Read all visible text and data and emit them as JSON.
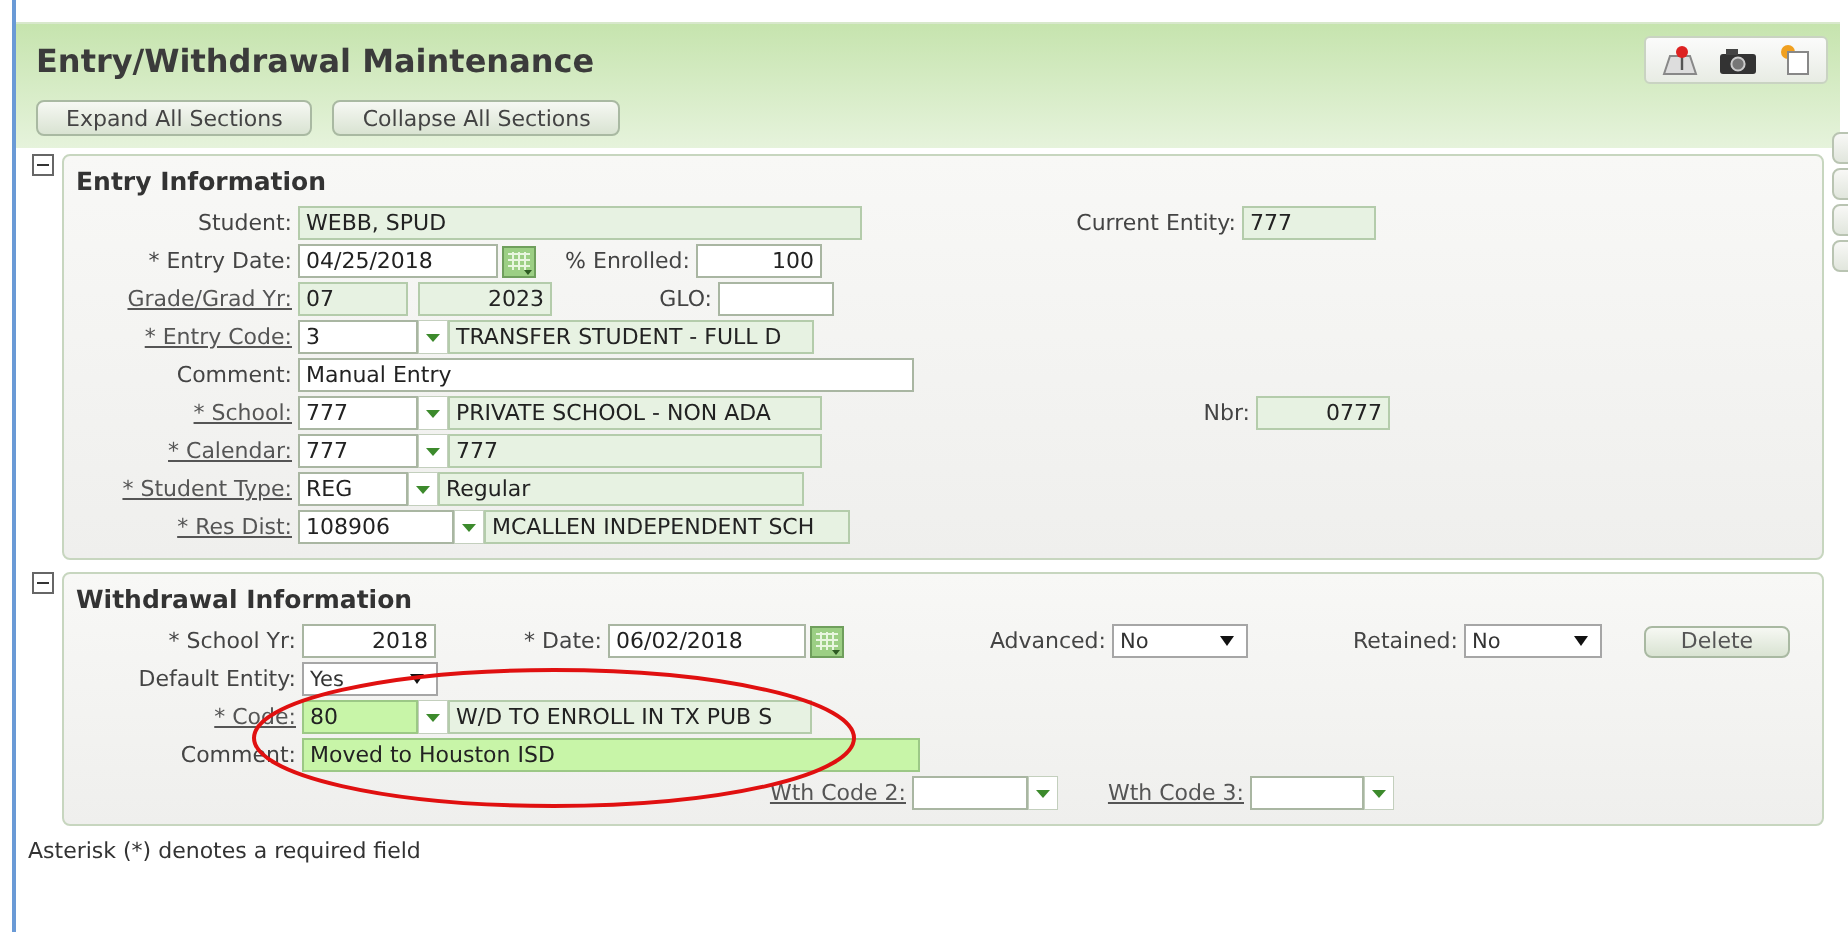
{
  "title": "Entry/Withdrawal Maintenance",
  "toolbar_buttons": [
    "Expand All Sections",
    "Collapse All Sections"
  ],
  "sections": [
    {
      "title": "Entry Information",
      "expanded": true,
      "rows": [
        {
          "fields": [
            {
              "kind": "text",
              "label": "Student:",
              "value": "WEBB, SPUD",
              "link": false,
              "readonly": true,
              "highlighted": false
            },
            {
              "kind": "text",
              "label": "Current Entity:",
              "value": "777",
              "link": false,
              "readonly": true,
              "highlighted": false
            }
          ]
        },
        {
          "fields": [
            {
              "kind": "date",
              "label": "* Entry Date:",
              "value": "04/25/2018",
              "link": false,
              "readonly": false,
              "highlighted": false
            },
            {
              "kind": "text",
              "label": "% Enrolled:",
              "value": "100",
              "link": false,
              "readonly": false,
              "highlighted": false
            }
          ]
        },
        {
          "fields": [
            {
              "kind": "pair",
              "label": "Grade/Grad Yr:",
              "values": [
                "07",
                "2023"
              ],
              "link": true,
              "readonly": true,
              "highlighted": false
            },
            {
              "kind": "text",
              "label": "GLO:",
              "link": false,
              "readonly": false,
              "highlighted": false
            }
          ]
        },
        {
          "fields": [
            {
              "kind": "combo",
              "label": "* Entry Code:",
              "code": "3",
              "desc": "TRANSFER STUDENT - FULL D",
              "link": true,
              "highlighted": false
            }
          ]
        },
        {
          "fields": [
            {
              "kind": "text",
              "label": "Comment:",
              "value": "Manual Entry",
              "link": false,
              "readonly": false,
              "highlighted": false
            }
          ]
        },
        {
          "fields": [
            {
              "kind": "combo",
              "label": "* School:",
              "code": "777",
              "desc": "PRIVATE SCHOOL - NON ADA",
              "link": true,
              "highlighted": false
            },
            {
              "kind": "text",
              "label": "Nbr:",
              "value": "0777",
              "link": false,
              "readonly": true,
              "highlighted": false
            }
          ]
        },
        {
          "fields": [
            {
              "kind": "combo",
              "label": "* Calendar:",
              "code": "777",
              "desc": "777",
              "link": true,
              "highlighted": false
            }
          ]
        },
        {
          "fields": [
            {
              "kind": "combo",
              "label": "* Student Type:",
              "code": "REG",
              "desc": "Regular",
              "link": true,
              "highlighted": false
            }
          ]
        },
        {
          "fields": [
            {
              "kind": "combo",
              "label": "* Res Dist:",
              "code": "108906",
              "desc": "MCALLEN INDEPENDENT SCH",
              "link": true,
              "highlighted": false
            }
          ]
        }
      ]
    },
    {
      "title": "Withdrawal Information",
      "expanded": true,
      "rows": [
        {
          "fields": [
            {
              "kind": "text",
              "label": "* School Yr:",
              "value": "2018",
              "link": false,
              "readonly": false,
              "highlighted": false
            },
            {
              "kind": "date",
              "label": "* Date:",
              "value": "06/02/2018",
              "link": false,
              "readonly": false,
              "highlighted": false
            },
            {
              "kind": "select",
              "label": "Advanced:",
              "value": "No",
              "link": false
            },
            {
              "kind": "select",
              "label": "Retained:",
              "value": "No",
              "link": false
            },
            {
              "kind": "button",
              "label": "Delete"
            }
          ]
        },
        {
          "fields": [
            {
              "kind": "select",
              "label": "Default Entity:",
              "value": "Yes",
              "link": false
            }
          ]
        },
        {
          "fields": [
            {
              "kind": "combo",
              "label": "* Code:",
              "code": "80",
              "desc": "W/D TO ENROLL IN TX PUB S",
              "link": true,
              "highlighted": true
            }
          ]
        },
        {
          "fields": [
            {
              "kind": "text",
              "label": "Comment:",
              "value": "Moved to Houston ISD",
              "link": false,
              "readonly": false,
              "highlighted": true
            }
          ]
        },
        {
          "fields": [
            {
              "kind": "combo",
              "label": "Wth Code 2:",
              "link": true,
              "highlighted": false
            },
            {
              "kind": "combo",
              "label": "Wth Code 3:",
              "link": true,
              "highlighted": false
            }
          ]
        }
      ]
    }
  ],
  "note": "Asterisk (*) denotes a required field"
}
